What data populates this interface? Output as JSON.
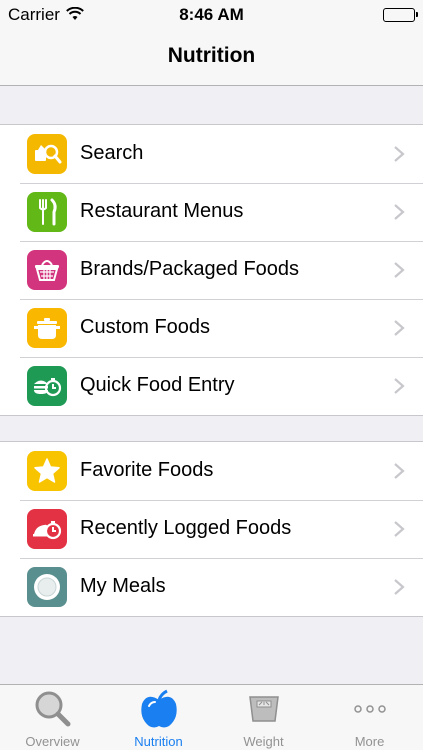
{
  "status_bar": {
    "carrier": "Carrier",
    "time": "8:46 AM"
  },
  "nav": {
    "title": "Nutrition"
  },
  "group1": [
    {
      "label": "Search",
      "icon": "search-icon",
      "color": "#f5b800"
    },
    {
      "label": "Restaurant Menus",
      "icon": "fork-knife-icon",
      "color": "#62b817"
    },
    {
      "label": "Brands/Packaged Foods",
      "icon": "basket-icon",
      "color": "#d2357d"
    },
    {
      "label": "Custom Foods",
      "icon": "pot-icon",
      "color": "#f9b700"
    },
    {
      "label": "Quick Food Entry",
      "icon": "quick-food-icon",
      "color": "#1f9a55"
    }
  ],
  "group2": [
    {
      "label": "Favorite Foods",
      "icon": "star-icon",
      "color": "#f8c400"
    },
    {
      "label": "Recently Logged Foods",
      "icon": "recent-icon",
      "color": "#e23244"
    },
    {
      "label": "My Meals",
      "icon": "plate-icon",
      "color": "#5a8f8f"
    }
  ],
  "tabs": [
    {
      "label": "Overview",
      "icon": "magnifier-icon",
      "active": false
    },
    {
      "label": "Nutrition",
      "icon": "apple-icon",
      "active": true
    },
    {
      "label": "Weight",
      "icon": "scale-icon",
      "active": false
    },
    {
      "label": "More",
      "icon": "more-icon",
      "active": false
    }
  ],
  "colors": {
    "accent": "#1a7ff0",
    "inactive_tab": "#929292"
  }
}
